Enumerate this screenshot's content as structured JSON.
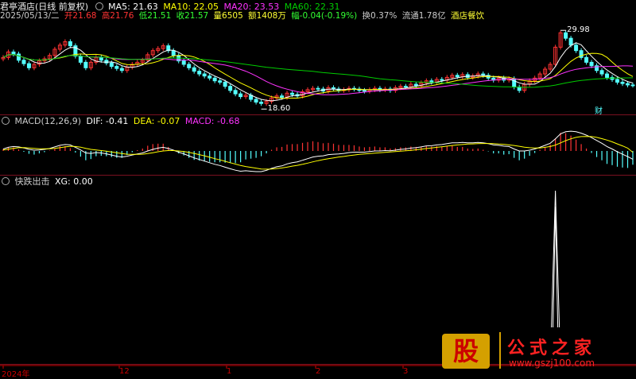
{
  "colors": {
    "up": "#ff3333",
    "down": "#54ffff",
    "ma5": "#ffffff",
    "ma10": "#ffff00",
    "ma20": "#ff33ff",
    "ma60": "#00cc00",
    "dif": "#ffffff",
    "dea": "#ffff00",
    "macd": "#ff33ff",
    "separator": "#7a1020",
    "axis": "#cc0000"
  },
  "header": {
    "title": "君亭酒店(日线 前复权)",
    "ma5_label": "MA5: 21.63",
    "ma10_label": "MA10: 22.05",
    "ma20_label": "MA20: 23.53",
    "ma60_label": "MA60: 22.31"
  },
  "info_bar": {
    "date": "2025/05/13/二",
    "open": "开21.68",
    "high": "高21.76",
    "low": "低21.51",
    "close": "收21.57",
    "volume": "量6505",
    "amount": "额1408万",
    "change": "幅-0.04(-0.19%)",
    "turnover": "换0.37%",
    "float_cap": "流通1.78亿",
    "industry": "酒店餐饮"
  },
  "price_chart": {
    "high_label": "29.98",
    "low_label": "18.60",
    "badge": "财"
  },
  "macd_panel": {
    "label": "MACD(12,26,9)",
    "dif": "DIF: -0.41",
    "dea": "DEA: -0.07",
    "macd": "MACD: -0.68"
  },
  "xg_panel": {
    "label": "快跌出击",
    "xg": "XG: 0.00"
  },
  "x_axis": {
    "ticks": [
      "2024年",
      "12",
      "1",
      "2",
      "3"
    ]
  },
  "logo": {
    "text": "公式之家",
    "char": "股",
    "url": "www.gszj100.com"
  },
  "chart_data": [
    {
      "type": "candlestick",
      "title": "君亭酒店(日线 前复权)",
      "series": [
        {
          "name": "MA5",
          "value": 21.63
        },
        {
          "name": "MA10",
          "value": 22.05
        },
        {
          "name": "MA20",
          "value": 23.53
        },
        {
          "name": "MA60",
          "value": 22.31
        }
      ],
      "annotations": [
        {
          "label": "29.98",
          "kind": "high"
        },
        {
          "label": "18.60",
          "kind": "low"
        }
      ],
      "ylim": [
        18.0,
        30.5
      ],
      "close": [
        25.6,
        26.4,
        26.1,
        25.2,
        24.7,
        24.1,
        24.6,
        25.1,
        25.4,
        25.9,
        26.8,
        27.4,
        27.9,
        27.3,
        25.8,
        24.9,
        24.1,
        24.9,
        25.6,
        25.2,
        24.8,
        24.3,
        24.0,
        23.7,
        24.2,
        24.6,
        24.9,
        25.2,
        26.0,
        26.6,
        26.9,
        27.3,
        26.6,
        25.9,
        25.1,
        24.6,
        24.1,
        23.6,
        23.2,
        22.9,
        22.6,
        22.2,
        22.0,
        21.4,
        20.8,
        20.3,
        19.9,
        20.1,
        19.5,
        19.1,
        18.9,
        19.2,
        19.7,
        20.0,
        19.8,
        20.4,
        20.2,
        20.0,
        20.6,
        20.9,
        21.1,
        21.0,
        20.7,
        21.2,
        21.0,
        20.8,
        20.9,
        21.1,
        21.0,
        20.8,
        20.7,
        20.9,
        21.1,
        20.9,
        21.0,
        20.8,
        21.2,
        21.4,
        21.3,
        21.7,
        21.5,
        21.9,
        22.2,
        22.0,
        22.4,
        22.3,
        22.7,
        23.0,
        22.8,
        23.1,
        22.7,
        22.9,
        23.2,
        23.0,
        22.6,
        22.3,
        22.6,
        22.3,
        22.5,
        21.3,
        20.8,
        21.7,
        22.2,
        22.6,
        23.2,
        23.9,
        24.6,
        27.1,
        29.2,
        28.4,
        27.4,
        26.6,
        25.6,
        24.9,
        24.4,
        23.7,
        23.2,
        22.7,
        22.4,
        22.0,
        21.8,
        21.6,
        21.57
      ],
      "dif": [
        0.1,
        0.18,
        0.22,
        0.2,
        0.15,
        0.08,
        0.04,
        0.05,
        0.08,
        0.12,
        0.2,
        0.28,
        0.32,
        0.3,
        0.18,
        0.05,
        -0.1,
        -0.12,
        -0.08,
        -0.1,
        -0.14,
        -0.2,
        -0.26,
        -0.3,
        -0.26,
        -0.2,
        -0.15,
        -0.1,
        0.0,
        0.08,
        0.14,
        0.18,
        0.12,
        0.04,
        -0.06,
        -0.14,
        -0.24,
        -0.34,
        -0.42,
        -0.5,
        -0.58,
        -0.66,
        -0.72,
        -0.8,
        -0.88,
        -0.95,
        -1.0,
        -0.98,
        -1.0,
        -1.02,
        -1.02,
        -0.96,
        -0.86,
        -0.78,
        -0.74,
        -0.64,
        -0.58,
        -0.54,
        -0.46,
        -0.38,
        -0.3,
        -0.26,
        -0.24,
        -0.18,
        -0.16,
        -0.15,
        -0.12,
        -0.08,
        -0.06,
        -0.06,
        -0.06,
        -0.03,
        0.0,
        0.0,
        0.02,
        0.01,
        0.04,
        0.08,
        0.1,
        0.14,
        0.16,
        0.2,
        0.25,
        0.26,
        0.3,
        0.32,
        0.36,
        0.4,
        0.4,
        0.42,
        0.4,
        0.4,
        0.42,
        0.4,
        0.36,
        0.3,
        0.28,
        0.24,
        0.22,
        0.1,
        0.0,
        0.0,
        0.04,
        0.1,
        0.18,
        0.28,
        0.38,
        0.6,
        0.85,
        0.95,
        0.98,
        0.95,
        0.88,
        0.78,
        0.66,
        0.52,
        0.38,
        0.22,
        0.1,
        -0.04,
        -0.16,
        -0.28,
        -0.41
      ],
      "dea": [
        0.05,
        0.09,
        0.13,
        0.16,
        0.17,
        0.15,
        0.13,
        0.11,
        0.11,
        0.11,
        0.13,
        0.16,
        0.2,
        0.23,
        0.22,
        0.19,
        0.13,
        0.08,
        0.05,
        0.02,
        -0.01,
        -0.05,
        -0.09,
        -0.13,
        -0.16,
        -0.17,
        -0.17,
        -0.16,
        -0.13,
        -0.09,
        -0.04,
        0.0,
        0.02,
        0.02,
        0.0,
        -0.03,
        -0.07,
        -0.12,
        -0.18,
        -0.24,
        -0.31,
        -0.38,
        -0.44,
        -0.51,
        -0.58,
        -0.65,
        -0.72,
        -0.77,
        -0.81,
        -0.85,
        -0.89,
        -0.9,
        -0.89,
        -0.87,
        -0.84,
        -0.8,
        -0.75,
        -0.71,
        -0.66,
        -0.6,
        -0.54,
        -0.48,
        -0.43,
        -0.38,
        -0.34,
        -0.3,
        -0.27,
        -0.23,
        -0.2,
        -0.17,
        -0.15,
        -0.13,
        -0.11,
        -0.09,
        -0.07,
        -0.05,
        -0.03,
        -0.01,
        0.01,
        0.03,
        0.06,
        0.09,
        0.12,
        0.15,
        0.18,
        0.21,
        0.24,
        0.27,
        0.3,
        0.32,
        0.34,
        0.35,
        0.36,
        0.37,
        0.37,
        0.36,
        0.34,
        0.33,
        0.3,
        0.27,
        0.23,
        0.19,
        0.16,
        0.15,
        0.15,
        0.18,
        0.22,
        0.29,
        0.4,
        0.51,
        0.6,
        0.67,
        0.71,
        0.72,
        0.71,
        0.67,
        0.61,
        0.54,
        0.45,
        0.35,
        0.25,
        0.14,
        -0.07
      ],
      "xg": {
        "spike_index": 107,
        "value": 1,
        "current": 0.0
      }
    }
  ]
}
